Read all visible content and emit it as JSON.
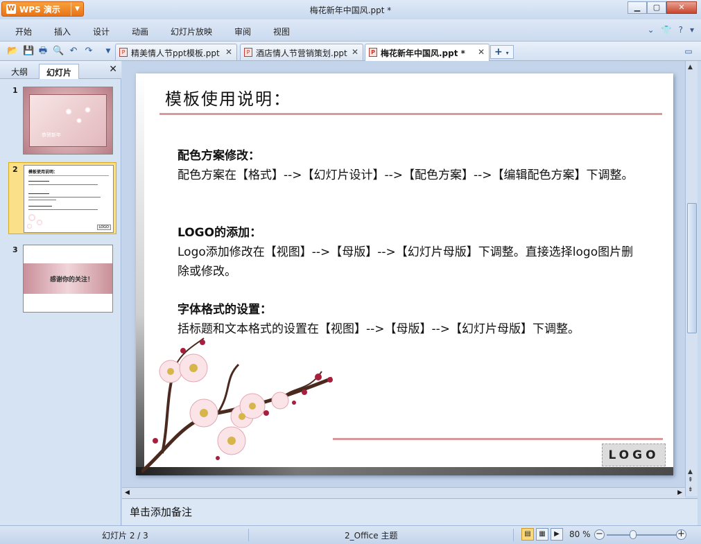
{
  "app": {
    "name": "WPS 演示",
    "window_title": "梅花新年中国风.ppt *"
  },
  "menu": [
    "开始",
    "插入",
    "设计",
    "动画",
    "幻灯片放映",
    "审阅",
    "视图"
  ],
  "tabs": [
    {
      "label": "精美情人节ppt模板.ppt"
    },
    {
      "label": "酒店情人节营销策划.ppt"
    },
    {
      "label": "梅花新年中国风.ppt *"
    }
  ],
  "panel": {
    "tabs": [
      "大纲",
      "幻灯片"
    ],
    "slides": [
      {
        "num": "1",
        "caption": "恭贺新年"
      },
      {
        "num": "2",
        "caption": "模板使用说明：",
        "logo": "LOGO"
      },
      {
        "num": "3",
        "caption": "感谢你的关注！"
      }
    ]
  },
  "slide": {
    "title": "模板使用说明：",
    "sections": [
      {
        "heading": "配色方案修改：",
        "body": "配色方案在【格式】-->【幻灯片设计】-->【配色方案】-->【编辑配色方案】下调整。"
      },
      {
        "heading": "LOGO的添加：",
        "body": "Logo添加修改在【视图】-->【母版】-->【幻灯片母版】下调整。直接选择logo图片删除或修改。"
      },
      {
        "heading": "字体格式的设置：",
        "body": "括标题和文本格式的设置在【视图】-->【母版】-->【幻灯片母版】下调整。"
      }
    ],
    "logo_text": "LOGO"
  },
  "notes": {
    "placeholder": "单击添加备注"
  },
  "status": {
    "slide_counter": "幻灯片 2 / 3",
    "theme": "2_Office 主题",
    "zoom": "80 %"
  },
  "colors": {
    "accent_orange": "#e8731a",
    "title_line": "#d9999a"
  }
}
